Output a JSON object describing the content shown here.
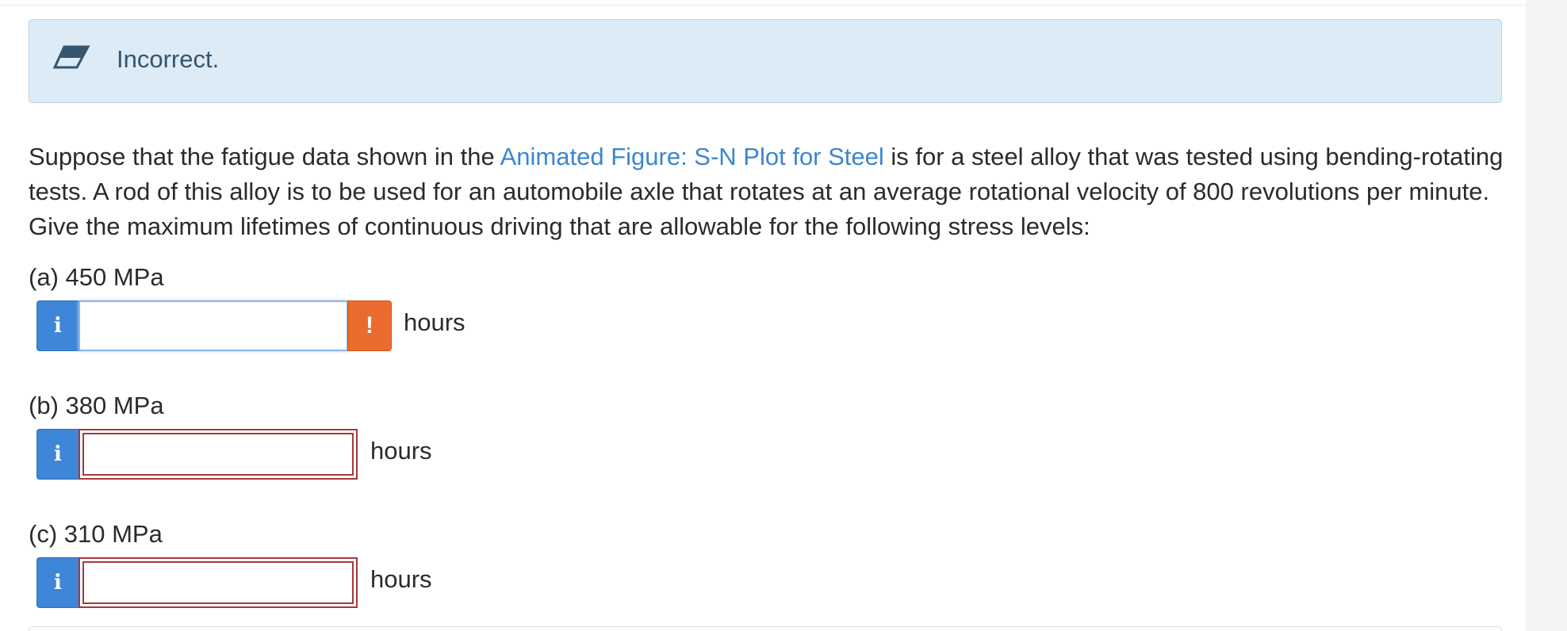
{
  "feedback": {
    "status_text": "Incorrect.",
    "icon": "eraser-icon"
  },
  "question": {
    "text_before_link": "Suppose that the fatigue data shown in the ",
    "link_text": "Animated Figure: S-N Plot for Steel",
    "text_after_link": " is for a steel alloy that was tested using bending-rotating tests.  A rod of this alloy is to be used for an automobile axle that rotates at an average rotational velocity of 800 revolutions per minute.  Give the maximum lifetimes of continuous driving that are allowable for the following stress levels:"
  },
  "parts": [
    {
      "label": "(a) 450 MPa",
      "value": "",
      "unit": "hours",
      "info_icon": "i",
      "alert_icon": "!"
    },
    {
      "label": "(b) 380 MPa",
      "value": "",
      "unit": "hours",
      "info_icon": "i"
    },
    {
      "label": "(c) 310 MPa",
      "value": "",
      "unit": "hours",
      "info_icon": "i"
    }
  ],
  "colors": {
    "link": "#3a86cf",
    "info_button": "#3d86d8",
    "alert_button": "#ea6b2d",
    "error_border": "#a33a3a",
    "feedback_bg": "#dcebf6"
  }
}
